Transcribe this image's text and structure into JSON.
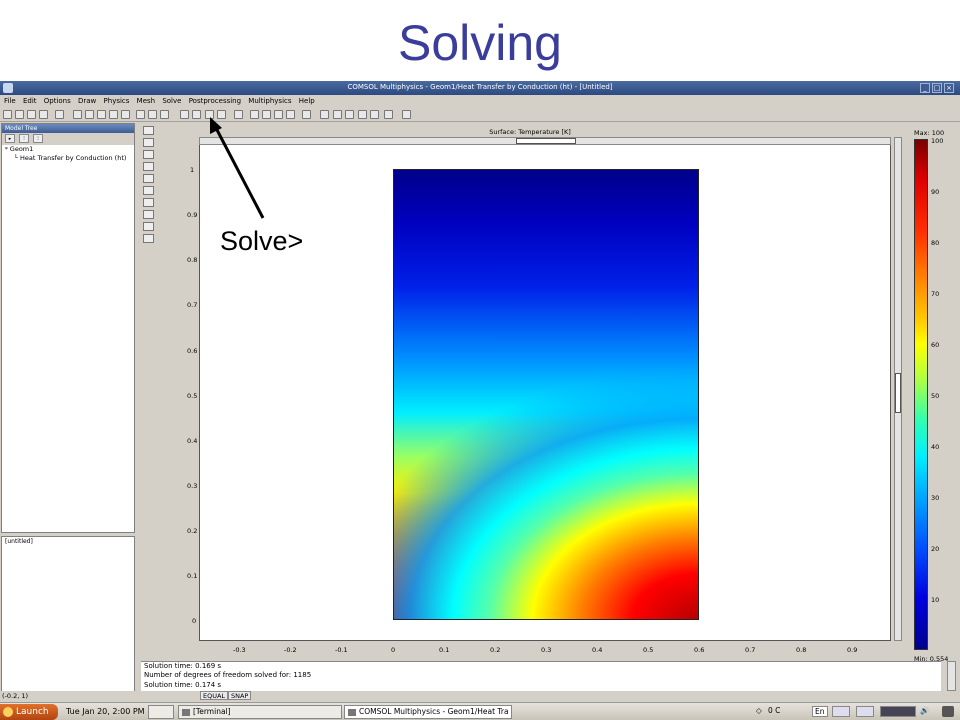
{
  "slide": {
    "title": "Solving",
    "callout": "Solve>"
  },
  "window": {
    "title": "COMSOL Multiphysics - Geom1/Heat Transfer by Conduction (ht) - [Untitled]"
  },
  "menu": [
    "File",
    "Edit",
    "Options",
    "Draw",
    "Physics",
    "Mesh",
    "Solve",
    "Postprocessing",
    "Multiphysics",
    "Help"
  ],
  "model_tree": {
    "header": "Model Tree",
    "nodes": {
      "root": "Geom1",
      "child": "Heat Transfer by Conduction (ht)"
    }
  },
  "properties": {
    "text": "[untitled]"
  },
  "plot": {
    "title": "Surface: Temperature [K]",
    "y_ticks": [
      "1",
      "0.9",
      "0.8",
      "0.7",
      "0.6",
      "0.5",
      "0.4",
      "0.3",
      "0.2",
      "0.1",
      "0"
    ],
    "x_ticks": [
      "-0.3",
      "-0.2",
      "-0.1",
      "0",
      "0.1",
      "0.2",
      "0.3",
      "0.4",
      "0.5",
      "0.6",
      "0.7",
      "0.8",
      "0.9"
    ]
  },
  "colorbar": {
    "max_label": "Max: 100",
    "min_label": "Min: 0.554",
    "ticks": [
      "100",
      "90",
      "80",
      "70",
      "60",
      "50",
      "40",
      "30",
      "20",
      "10"
    ]
  },
  "log": {
    "line1": "Solution time: 0.169 s",
    "line2": "Number of degrees of freedom solved for: 1185",
    "line3": "Solution time: 0.174 s"
  },
  "status": {
    "coords": "(-0.2, 1)",
    "equal": "EQUAL",
    "snap": "SNAP"
  },
  "taskbar": {
    "launch": "Launch",
    "clock": "Tue Jan 20,  2:00 PM",
    "task_terminal": "[Terminal]",
    "task_comsol": "COMSOL Multiphysics - Geom1/Heat Tra",
    "temp": "0 C",
    "lang": "En"
  }
}
